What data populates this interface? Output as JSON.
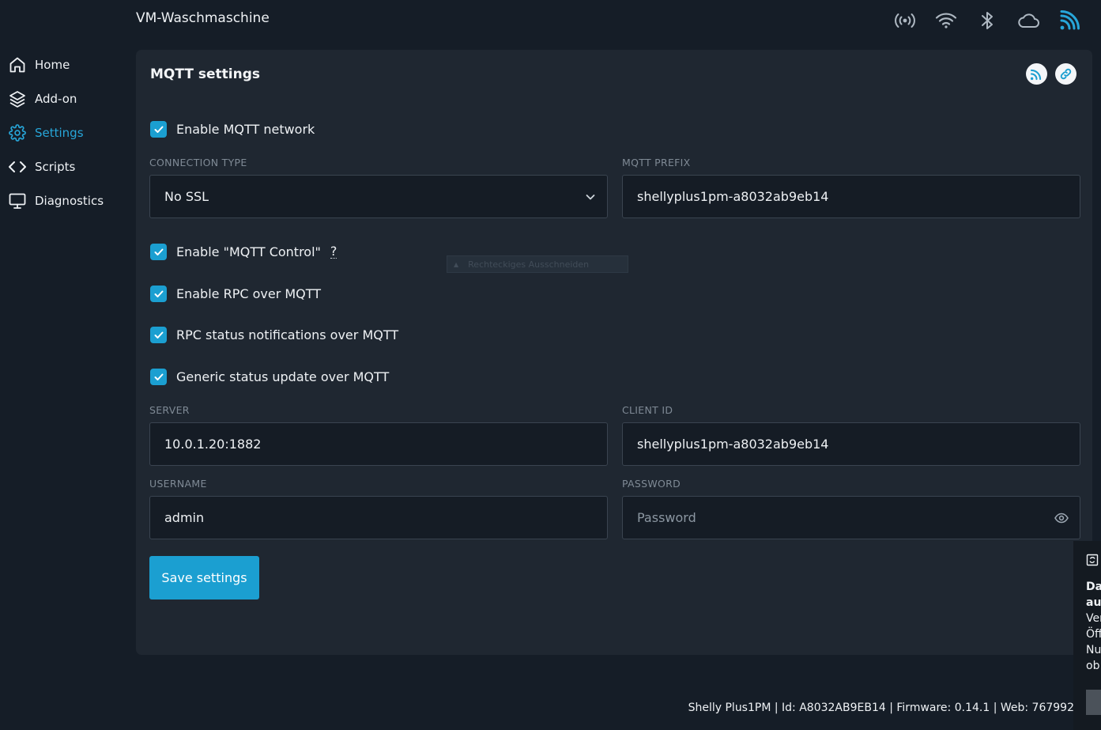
{
  "app": {
    "device_name": "VM-Waschmaschine"
  },
  "topbar": {
    "icons": [
      "broadcast-icon",
      "wifi-icon",
      "bluetooth-icon",
      "cloud-icon",
      "mqtt-icon"
    ],
    "accent": "#27a6d9"
  },
  "sidebar": {
    "items": [
      {
        "label": "Home",
        "icon": "home-icon"
      },
      {
        "label": "Add-on",
        "icon": "layers-icon"
      },
      {
        "label": "Settings",
        "icon": "gear-icon",
        "active": true
      },
      {
        "label": "Scripts",
        "icon": "code-icon"
      },
      {
        "label": "Diagnostics",
        "icon": "monitor-icon"
      }
    ]
  },
  "card": {
    "title": "MQTT settings",
    "actions": [
      "rss-icon",
      "link-icon"
    ]
  },
  "form": {
    "enable_mqtt": {
      "label": "Enable MQTT network",
      "checked": true
    },
    "connection_type": {
      "label": "CONNECTION TYPE",
      "value": "No SSL"
    },
    "mqtt_prefix": {
      "label": "MQTT PREFIX",
      "value": "shellyplus1pm-a8032ab9eb14"
    },
    "mqtt_control": {
      "label": "Enable \"MQTT Control\"",
      "help": "?",
      "checked": true
    },
    "rpc_over_mqtt": {
      "label": "Enable RPC over MQTT",
      "checked": true
    },
    "rpc_status": {
      "label": "RPC status notifications over MQTT",
      "checked": true
    },
    "generic_status": {
      "label": "Generic status update over MQTT",
      "checked": true
    },
    "server": {
      "label": "SERVER",
      "value": "10.0.1.20:1882"
    },
    "client_id": {
      "label": "CLIENT ID",
      "value": "shellyplus1pm-a8032ab9eb14"
    },
    "username": {
      "label": "USERNAME",
      "value": "admin"
    },
    "password": {
      "label": "PASSWORD",
      "value": "",
      "placeholder": "Password"
    },
    "save_label": "Save settings"
  },
  "overlay": {
    "tooltip": "Rechteckiges Ausschneiden"
  },
  "toast": {
    "line1": "Da",
    "line2": "au",
    "line3": "Ver",
    "line4": "Öff",
    "line5": "Nu",
    "line6": "ob"
  },
  "footer": {
    "text": "Shelly Plus1PM | Id: A8032AB9EB14 | Firmware: 0.14.1 | Web: 767992"
  }
}
